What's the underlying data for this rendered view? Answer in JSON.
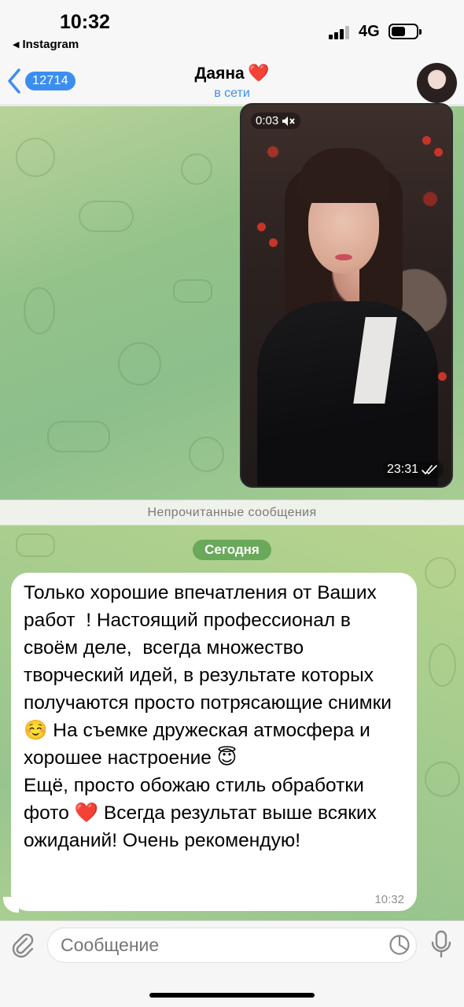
{
  "status_bar": {
    "time": "10:32",
    "back_app": "Instagram",
    "network": "4G"
  },
  "header": {
    "unread_count": "12714",
    "name": "Даяна",
    "name_emoji": "❤️",
    "status": "в сети"
  },
  "video_message": {
    "duration": "0:03",
    "muted_icon": "speaker-muted-icon",
    "timestamp": "23:31",
    "read_icon": "double-check-icon"
  },
  "unread_divider": "Непрочитанные сообщения",
  "date_separator": "Сегодня",
  "incoming_message": {
    "text": "Только хорошие впечатления от Ваших работ  ! Настоящий профессионал в своём деле,  всегда множество творческий идей, в результате которых получаются просто потрясающие снимки ☺️ На съемке дружеская атмосфера и хорошее настроение 😇\nЕщё, просто обожаю стиль обработки фото ❤️ Всегда результат выше всяких ожиданий! Очень рекомендую!",
    "time": "10:32"
  },
  "composer": {
    "placeholder": "Сообщение",
    "attach_icon": "paperclip-icon",
    "sticker_icon": "sticker-icon",
    "mic_icon": "microphone-icon"
  },
  "colors": {
    "accent": "#3b8ef0",
    "date_pill": "#6aa85a",
    "heart": "#e2202f"
  }
}
